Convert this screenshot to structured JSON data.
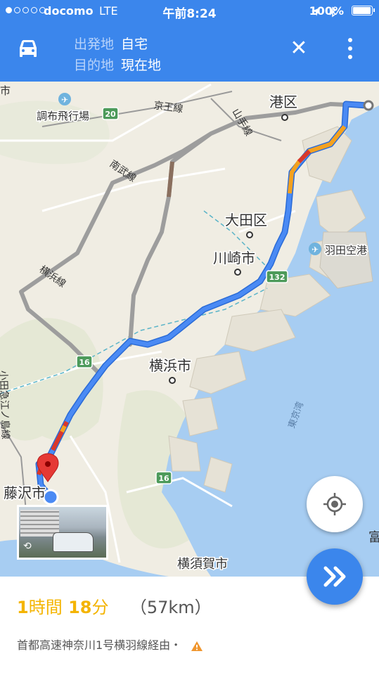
{
  "status_bar": {
    "signal_dots": [
      true,
      false,
      false,
      false,
      false
    ],
    "carrier": "docomo",
    "network": "LTE",
    "time": "午前8:24",
    "battery": "100%",
    "battery_level": 1.0
  },
  "header": {
    "origin_label": "出発地",
    "origin_value": "自宅",
    "destination_label": "目的地",
    "destination_value": "現在地",
    "mode_icon": "car-icon",
    "close_icon": "close-icon",
    "menu_icon": "more-vert-icon"
  },
  "map": {
    "places": {
      "minato": "港区",
      "ota": "大田区",
      "kawasaki": "川崎市",
      "yokohama": "横浜市",
      "fujisawa": "藤沢市",
      "yokosuka": "横須賀市",
      "haneda": "羽田空港",
      "chofu_airport": "調布飛行場",
      "tokyo_bay": "東京湾",
      "edge_top_left": "市",
      "edge_right": "富"
    },
    "rail": {
      "keio": "京王線",
      "yamanote": "山手線",
      "nambu": "南武線",
      "yokohama_line": "横浜線",
      "odakyu": "小田急江ノ島線"
    },
    "route_shields": [
      "20",
      "132",
      "16",
      "16"
    ],
    "colors": {
      "route": "#4a8af4",
      "traffic_slow": "#f4a11e",
      "traffic_heavy": "#d9382b",
      "alt_route": "#a6a6a6",
      "water": "#a7cdf2",
      "land": "#f2efe9"
    }
  },
  "controls": {
    "my_location_icon": "my-location-icon",
    "start_nav_icon": "double-chevron-right-icon",
    "street_view_rotate_icon": "rotate-360-icon"
  },
  "summary": {
    "hours": "1",
    "hours_unit": "時間",
    "minutes": "18",
    "minutes_unit": "分",
    "distance": "（57km）",
    "via": "首都高速神奈川1号横羽線経由・",
    "warning_icon": "warning-icon"
  }
}
